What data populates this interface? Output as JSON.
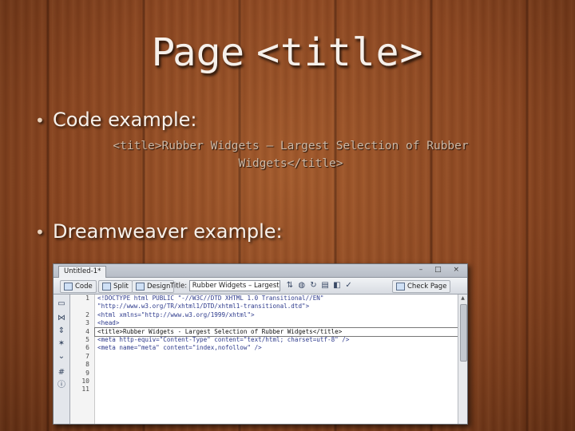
{
  "slide": {
    "title_word": "Page",
    "title_tag": "<title>",
    "bullet1": "Code example:",
    "code_line1": "<title>Rubber Widgets – Largest Selection of Rubber",
    "code_line2": "Widgets</title>",
    "bullet2": "Dreamweaver example:",
    "bullet_glyph": "•"
  },
  "dreamweaver": {
    "doc_tab": "Untitled-1*",
    "window_buttons": "– □ ×",
    "toolbar": {
      "code_label": "Code",
      "split_label": "Split",
      "design_label": "Design",
      "title_label": "Title:",
      "title_value": "Rubber Widgets – Largest Sel",
      "check_page_label": "Check Page"
    },
    "line_numbers": [
      "1",
      "",
      "2",
      "3",
      "4",
      "5",
      "6",
      "7",
      "8",
      "9",
      "10",
      "11"
    ],
    "code_lines": [
      "<!DOCTYPE html PUBLIC \"-//W3C//DTD XHTML 1.0 Transitional//EN\"",
      "\"http://www.w3.org/TR/xhtml1/DTD/xhtml1-transitional.dtd\">",
      "<html xmlns=\"http://www.w3.org/1999/xhtml\">",
      "<head>",
      "<title>Rubber Widgets - Largest Selection of Rubber Widgets</title>",
      "<meta http-equiv=\"Content-Type\" content=\"text/html; charset=utf-8\" />",
      "<meta name=\"meta\" content=\"index,nofollow\" />",
      "",
      "",
      "",
      "",
      ""
    ],
    "highlight_line_index": 4,
    "colors": {
      "code_text": "#2d3a8c",
      "highlight_outline": "#777777"
    }
  }
}
